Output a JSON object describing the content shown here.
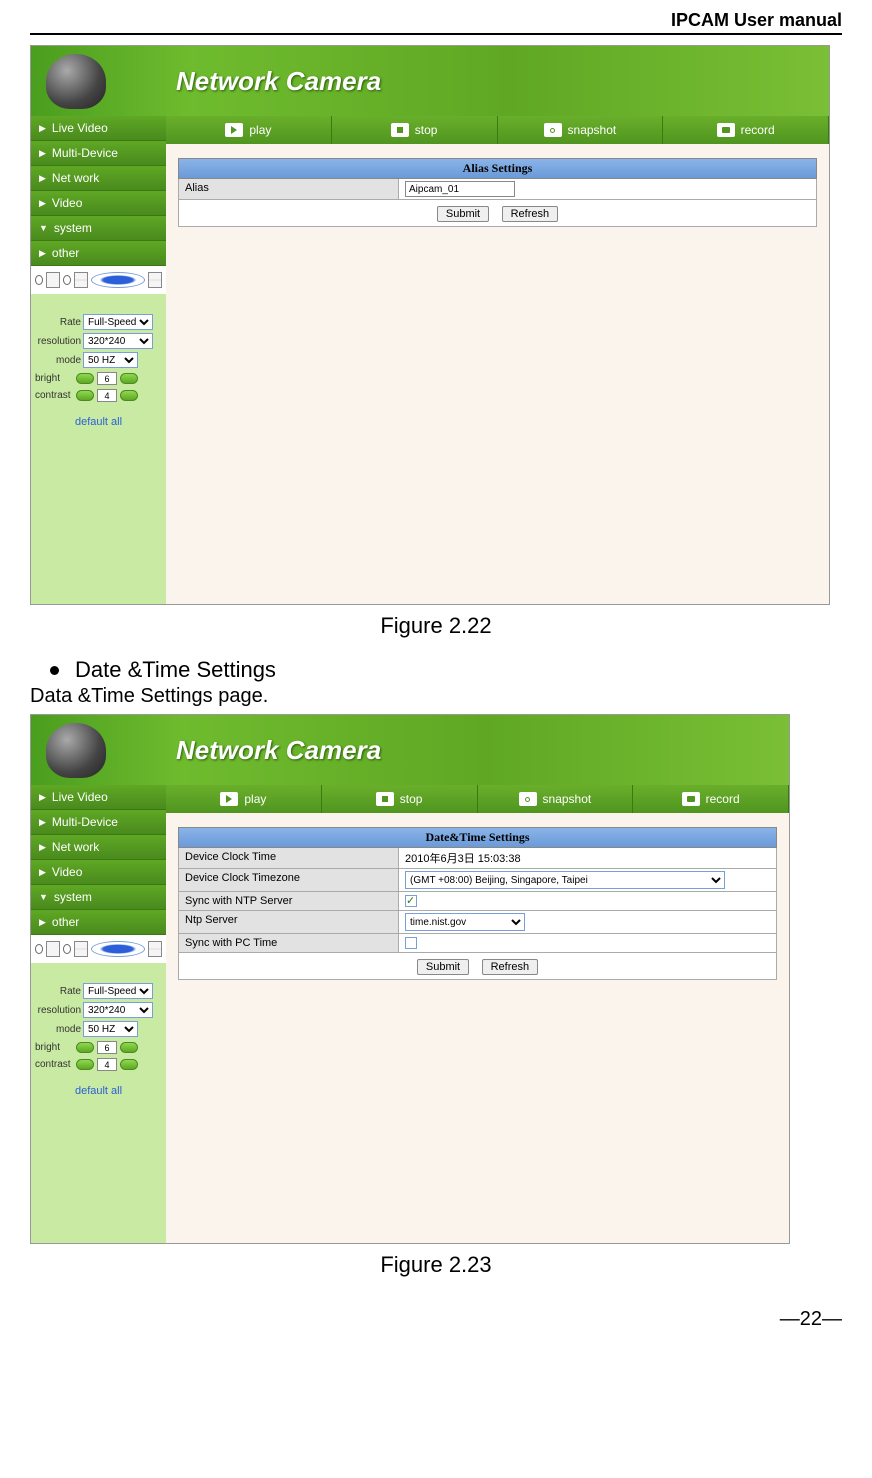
{
  "doc": {
    "header": "IPCAM User manual",
    "figure1_caption": "Figure 2.22",
    "bullet_heading": "Date &Time Settings",
    "body_line": "Data &Time Settings page.",
    "figure2_caption": "Figure 2.23",
    "page_number": "—22—"
  },
  "ui": {
    "header_title": "Network Camera",
    "nav": [
      "Live Video",
      "Multi-Device",
      "Net work",
      "Video",
      "system",
      "other"
    ],
    "nav_markers": [
      "▶",
      "▶",
      "▶",
      "▶",
      "▼",
      "▶"
    ],
    "toolbar": {
      "play": "play",
      "stop": "stop",
      "snapshot": "snapshot",
      "record": "record"
    },
    "controls": {
      "rate_label": "Rate",
      "rate_value": "Full-Speed",
      "resolution_label": "resolution",
      "resolution_value": "320*240",
      "mode_label": "mode",
      "mode_value": "50 HZ",
      "bright_label": "bright",
      "bright_value": "6",
      "contrast_label": "contrast",
      "contrast_value": "4",
      "default_link": "default all"
    },
    "alias_panel": {
      "title": "Alias Settings",
      "row_label": "Alias",
      "value": "Aipcam_01",
      "submit": "Submit",
      "refresh": "Refresh"
    },
    "datetime_panel": {
      "title": "Date&Time Settings",
      "rows": [
        {
          "label": "Device Clock Time",
          "value": "2010年6月3日  15:03:38",
          "type": "text"
        },
        {
          "label": "Device Clock Timezone",
          "value": "(GMT +08:00) Beijing, Singapore, Taipei",
          "type": "select"
        },
        {
          "label": "Sync with NTP Server",
          "value": "",
          "type": "check_on"
        },
        {
          "label": "Ntp Server",
          "value": "time.nist.gov",
          "type": "select_small"
        },
        {
          "label": "Sync with PC Time",
          "value": "",
          "type": "check_off"
        }
      ],
      "submit": "Submit",
      "refresh": "Refresh"
    }
  }
}
